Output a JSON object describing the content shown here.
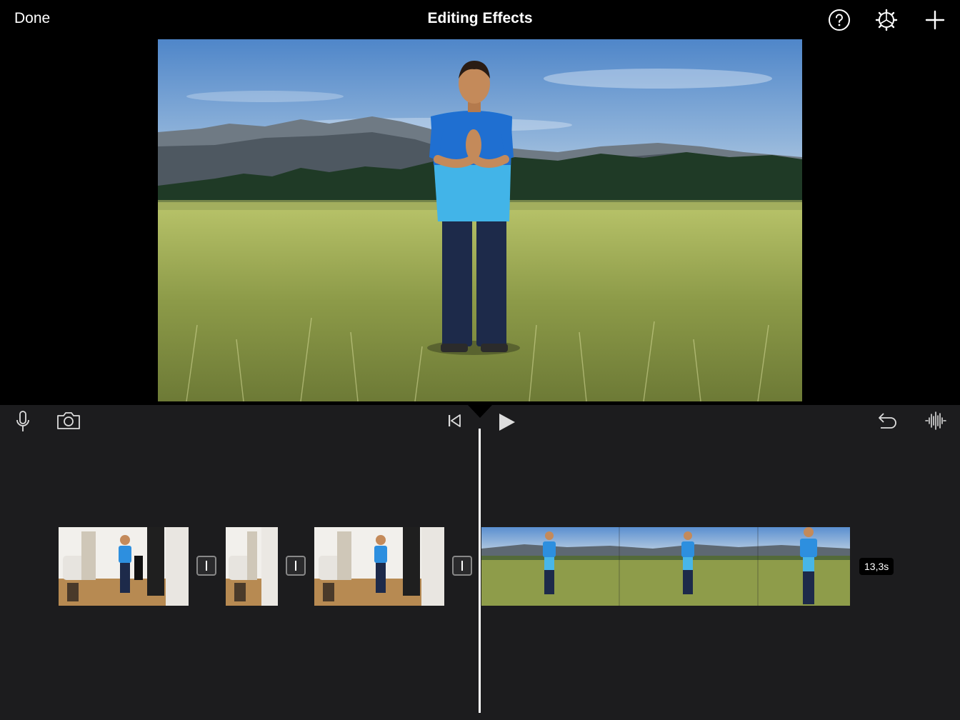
{
  "topbar": {
    "done_label": "Done",
    "title": "Editing Effects",
    "icons": [
      "help-icon",
      "settings-icon",
      "add-icon"
    ]
  },
  "controls": {
    "left_icons": [
      "microphone-icon",
      "camera-icon"
    ],
    "center_icons": [
      "skip-to-start-icon",
      "play-icon"
    ],
    "right_icons": [
      "undo-icon",
      "audio-waveform-icon"
    ]
  },
  "timeline": {
    "clips": [
      {
        "scene": "indoor"
      },
      {
        "scene": "indoor"
      },
      {
        "scene": "indoor"
      },
      {
        "scene": "outdoor"
      }
    ],
    "transitions": 3,
    "duration_label": "13,3s"
  },
  "colors": {
    "topbar_bg": "#000000",
    "editor_bg": "#1c1c1e",
    "playhead": "#ffffff",
    "shirt_blue": "#1f6fd1",
    "shirt_light": "#4cc3ef"
  }
}
